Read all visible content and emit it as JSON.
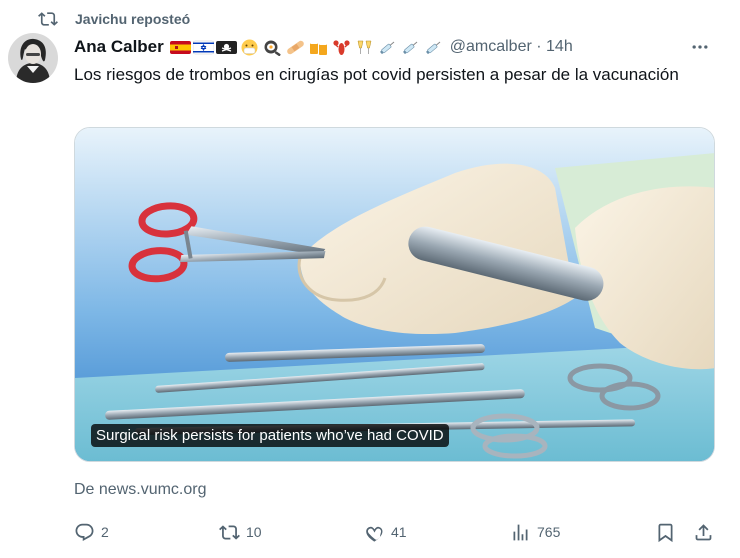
{
  "repost": {
    "icon": "repost-icon",
    "text": "Javichu reposteó"
  },
  "tweet": {
    "author": "Ana Calber",
    "emoji_icons": [
      "spain-flag-icon",
      "israel-flag-icon",
      "pirate-flag-icon",
      "mask-face-icon",
      "frying-pan-icon",
      "bandage-icon",
      "beer-mugs-icon",
      "lobster-icon",
      "champagne-glasses-icon",
      "syringe-icon",
      "syringe-icon",
      "syringe-icon"
    ],
    "handle_time": "@amcalber · 14h",
    "text": "Los riesgos de trombos en cirugías pot covid persisten a pesar de la vacunación",
    "media": {
      "caption": "Surgical risk persists for patients who’ve had COVID"
    },
    "source": "De news.vumc.org"
  },
  "actions": {
    "replies": "2",
    "reposts": "10",
    "likes": "41",
    "views": "765"
  },
  "colors": {
    "muted": "#536471",
    "text": "#0f1419",
    "border": "#cfd9de"
  }
}
